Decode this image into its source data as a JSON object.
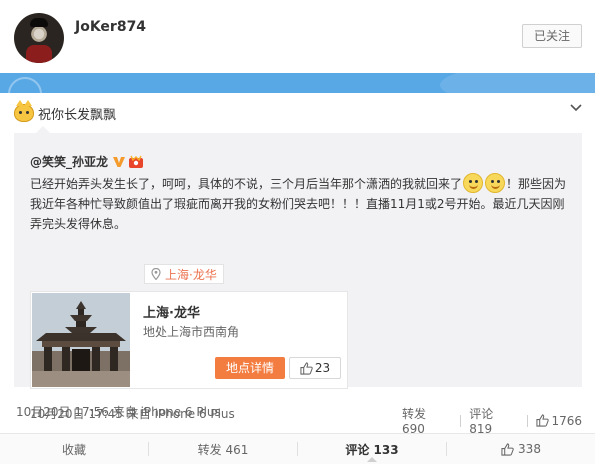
{
  "profile": {
    "username": "JoKer874",
    "follow_label": "已关注"
  },
  "post": {
    "text": "祝你长发飘飘",
    "time": "10月20日 17:56 来自 iPhone 6 Plus",
    "icons": {
      "emoji": "cat-emoji-icon",
      "chevron": "chevron-down-icon"
    }
  },
  "quote": {
    "author": "@笑笑_孙亚龙",
    "text_part1": "已经开始弄头发生长了，呵呵，具体的不说，三个月后当年那个潇洒的我就回来了",
    "text_part2": "！那些因为我近年各种忙导致颜值出了瑕疵而离开我的女粉们哭去吧！！！直播11月1或2号开始。最近几天因刚弄完头发得休息。",
    "location_tag": "上海·龙华",
    "time": "10月20日 17:45 来自 iPhone 6 Plus",
    "repost": "转发 690",
    "comment": "评论 819",
    "like_count": "1766",
    "location_card": {
      "title": "上海·龙华",
      "subtitle": "地处上海市西南角",
      "detail_label": "地点详情",
      "like_count": "23"
    }
  },
  "actions": {
    "favorite": "收藏",
    "repost": "转发 461",
    "comment": "评论 133",
    "like": "338"
  },
  "colors": {
    "band": "#58a8e6",
    "accent_orange": "#f37d41",
    "location_text": "#eb7350",
    "vip_orange": "#f59b2c"
  }
}
